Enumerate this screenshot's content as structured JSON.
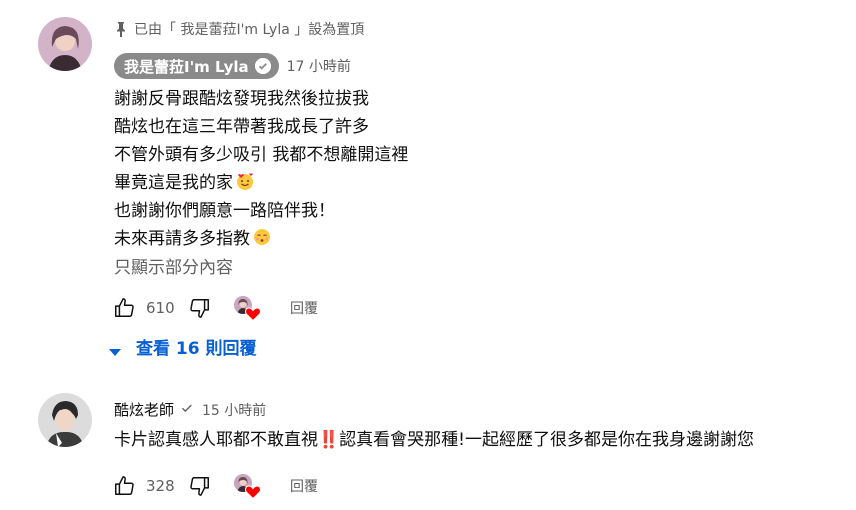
{
  "pinned_comment": {
    "pinned_label": "已由「 我是蕾菈I'm Lyla 」設為置頂",
    "author": "我是蕾菈I'm Lyla",
    "timestamp": "17 小時前",
    "lines": [
      "謝謝反骨跟酷炫發現我然後拉拔我",
      "酷炫也在這三年帶著我成長了許多",
      "不管外頭有多少吸引 我都不想離開這裡",
      "畢竟這是我的家",
      "也謝謝你們願意一路陪伴我！",
      "未來再請多多指教"
    ],
    "show_less": "只顯示部分內容",
    "like_count": "610",
    "reply_label": "回覆",
    "view_replies": {
      "prefix": "查看",
      "count": "16",
      "suffix": "則回覆"
    }
  },
  "second_comment": {
    "author": "酷炫老師",
    "timestamp": "15 小時前",
    "text": "卡片認真感人耶都不敢直視‼️認真看會哭那種!一起經歷了很多都是你在我身邊謝謝您",
    "like_count": "328",
    "reply_label": "回覆"
  },
  "icons": {
    "pin": "pin-icon",
    "verified": "check-icon",
    "like": "thumbs-up-icon",
    "dislike": "thumbs-down-icon",
    "heart": "heart-icon",
    "caret": "caret-down-icon"
  },
  "colors": {
    "link_blue": "#065fd4",
    "heart_red": "#ff0000",
    "author_chip_bg": "#8a8a8a",
    "muted_text": "#606060"
  }
}
